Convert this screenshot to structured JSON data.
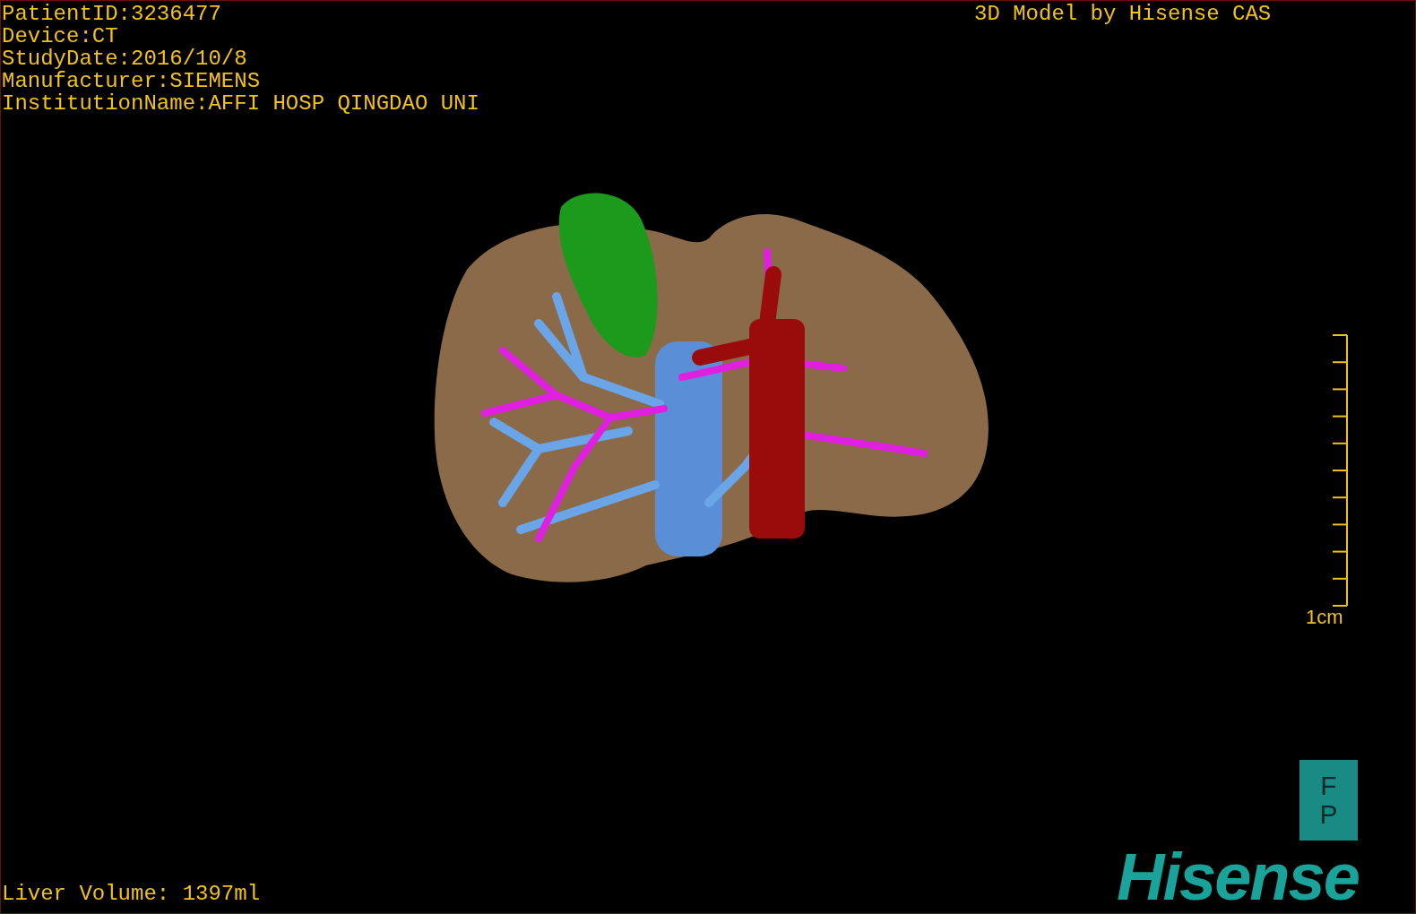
{
  "patient_info": [
    "PatientID:3236477",
    "Device:CT",
    "StudyDate:2016/10/8",
    "Manufacturer:SIEMENS",
    "InstitutionName:AFFI HOSP QINGDAO UNI"
  ],
  "credit": "3D Model by Hisense CAS",
  "scale_bar": {
    "label": "1cm"
  },
  "orientation_marker": [
    "F",
    "P"
  ],
  "logo": "Hisense",
  "liver_volume": "Liver Volume: 1397ml"
}
